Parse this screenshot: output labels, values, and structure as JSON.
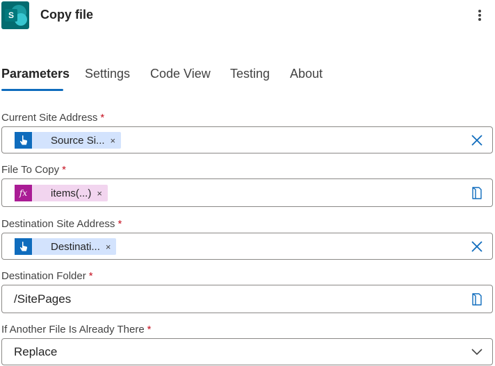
{
  "header": {
    "app_icon_letter": "S",
    "title": "Copy file",
    "more_icon": "more-vertical-icon"
  },
  "tabs": [
    {
      "label": "Parameters",
      "active": true
    },
    {
      "label": "Settings",
      "active": false
    },
    {
      "label": "Code View",
      "active": false
    },
    {
      "label": "Testing",
      "active": false
    },
    {
      "label": "About",
      "active": false
    }
  ],
  "required_mark": "*",
  "fields": {
    "current_site": {
      "label": "Current Site Address",
      "token_text": "Source Si...",
      "token_icon": "manual-trigger-icon",
      "action_icon": "clear-icon"
    },
    "file_to_copy": {
      "label": "File To Copy",
      "token_text": "items(...)",
      "token_icon": "fx",
      "action_icon": "folder-picker-icon"
    },
    "destination_site": {
      "label": "Destination Site Address",
      "token_text": "Destinati...",
      "token_icon": "manual-trigger-icon",
      "action_icon": "clear-icon"
    },
    "destination_folder": {
      "label": "Destination Folder",
      "value": "/SitePages",
      "action_icon": "folder-picker-icon"
    },
    "if_exists": {
      "label": "If Another File Is Already There",
      "value": "Replace",
      "action_icon": "chevron-down-icon"
    }
  },
  "token_remove": "×",
  "colors": {
    "accent": "#0f6cbd",
    "required": "#c50f1f",
    "token_blue": "#d3e3fd",
    "token_pink": "#f2d5ef",
    "sharepoint": "#036c70"
  }
}
